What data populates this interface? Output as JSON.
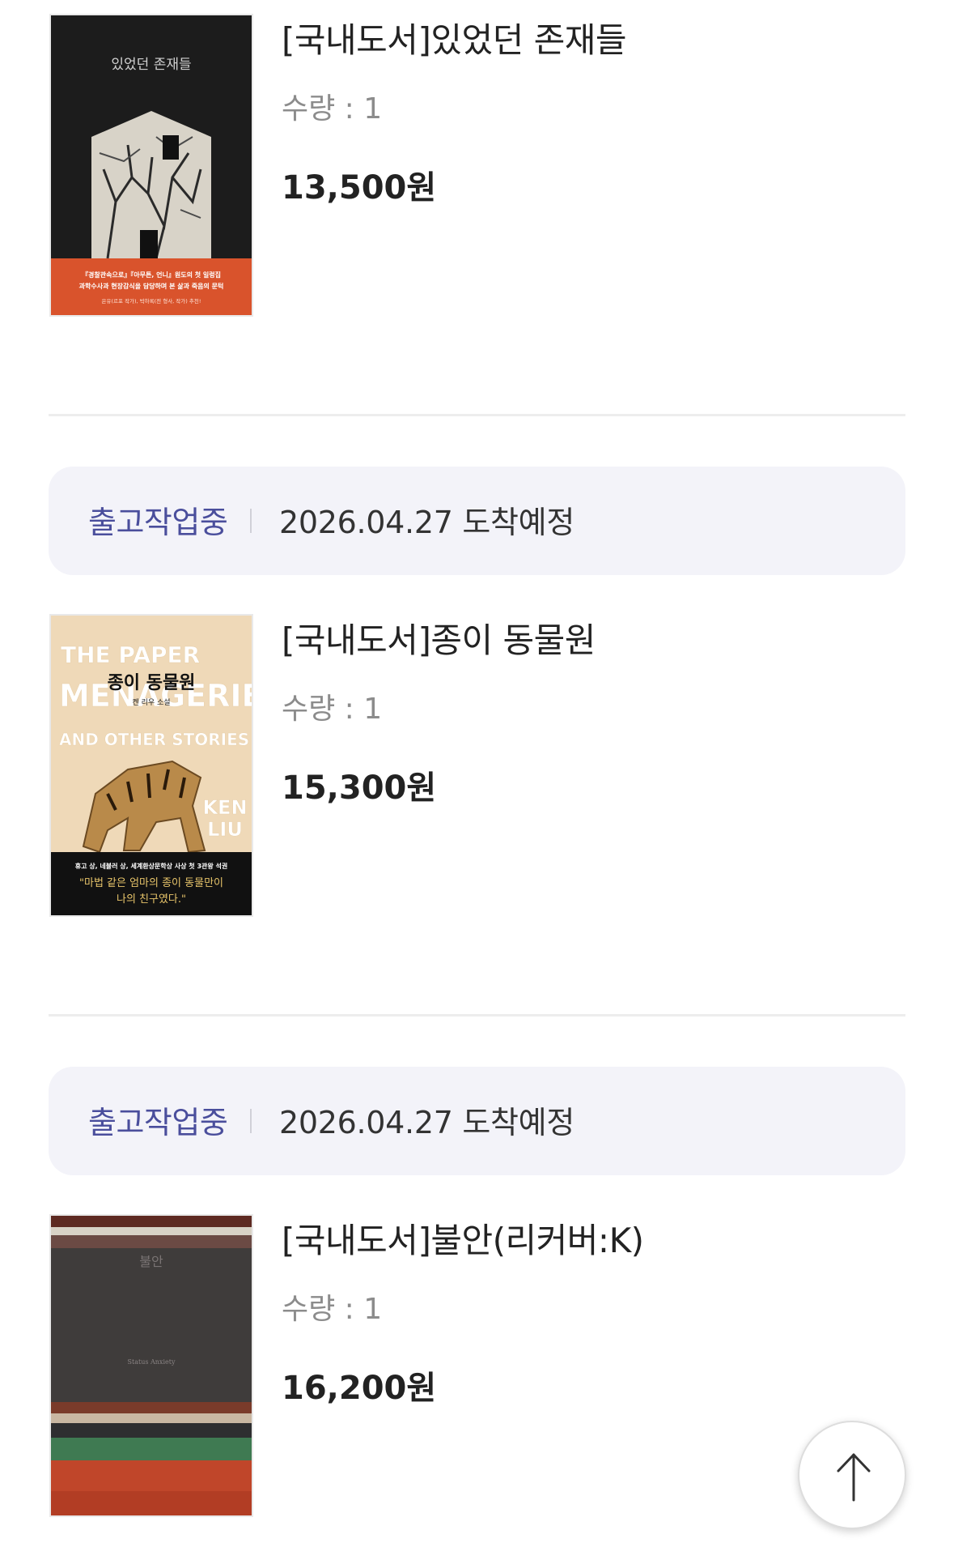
{
  "orders": [
    {
      "title": "[국내도서]있었던 존재들",
      "quantity": "수량 : 1",
      "price": "13,500원",
      "cover": {
        "title": "있었던 존재들",
        "band_line1": "『경찰관속으로』『아무튼, 언니』원도의 첫 일렁집",
        "band_line2": "과학수사과 현장감식을 담당하며 본 삶과 죽음의 문턱",
        "band_line3": "은유(르포 작가), 박하록(전 형사, 작가) 추천!",
        "colors": {
          "bg": "#1c1c1c",
          "band": "#d9532c"
        }
      }
    },
    {
      "status": "출고작업중",
      "arrival": "2026.04.27 도착예정",
      "title": "[국내도서]종이 동물원",
      "quantity": "수량 : 1",
      "price": "15,300원",
      "cover": {
        "title_en_1": "THE PAPER",
        "title_en_2": "MENAGERIE",
        "title_en_3": "AND OTHER STORIES",
        "title_ko": "종이 동물원",
        "author_ko": "켄 리우 소설",
        "author_en_1": "KEN",
        "author_en_2": "LIU",
        "band_line1": "휴고 상, 네뷸러 상, 세계환상문학상 사상 첫 3관왕 석권",
        "band_line2": "\"마법 같은 엄마의 종이 동물만이",
        "band_line3": "나의 친구였다.\"",
        "colors": {
          "bg": "#efd9b8",
          "band": "#111111",
          "quote": "#e8c56a"
        }
      }
    },
    {
      "status": "출고작업중",
      "arrival": "2026.04.27 도착예정",
      "title": "[국내도서]불안(리커버:K)",
      "quantity": "수량 : 1",
      "price": "16,200원",
      "cover": {
        "title": "불안",
        "subtitle": "Status Anxiety",
        "colors": {
          "bg": "#3d3a3a",
          "green": "#3f7a52",
          "red": "#c0462a"
        }
      }
    }
  ],
  "scroll_top": {
    "icon": "arrow-up-icon"
  },
  "colors": {
    "status_accent": "#4a4e9c",
    "status_bg": "#f3f3f9",
    "qty_gray": "#8c8c8c"
  }
}
